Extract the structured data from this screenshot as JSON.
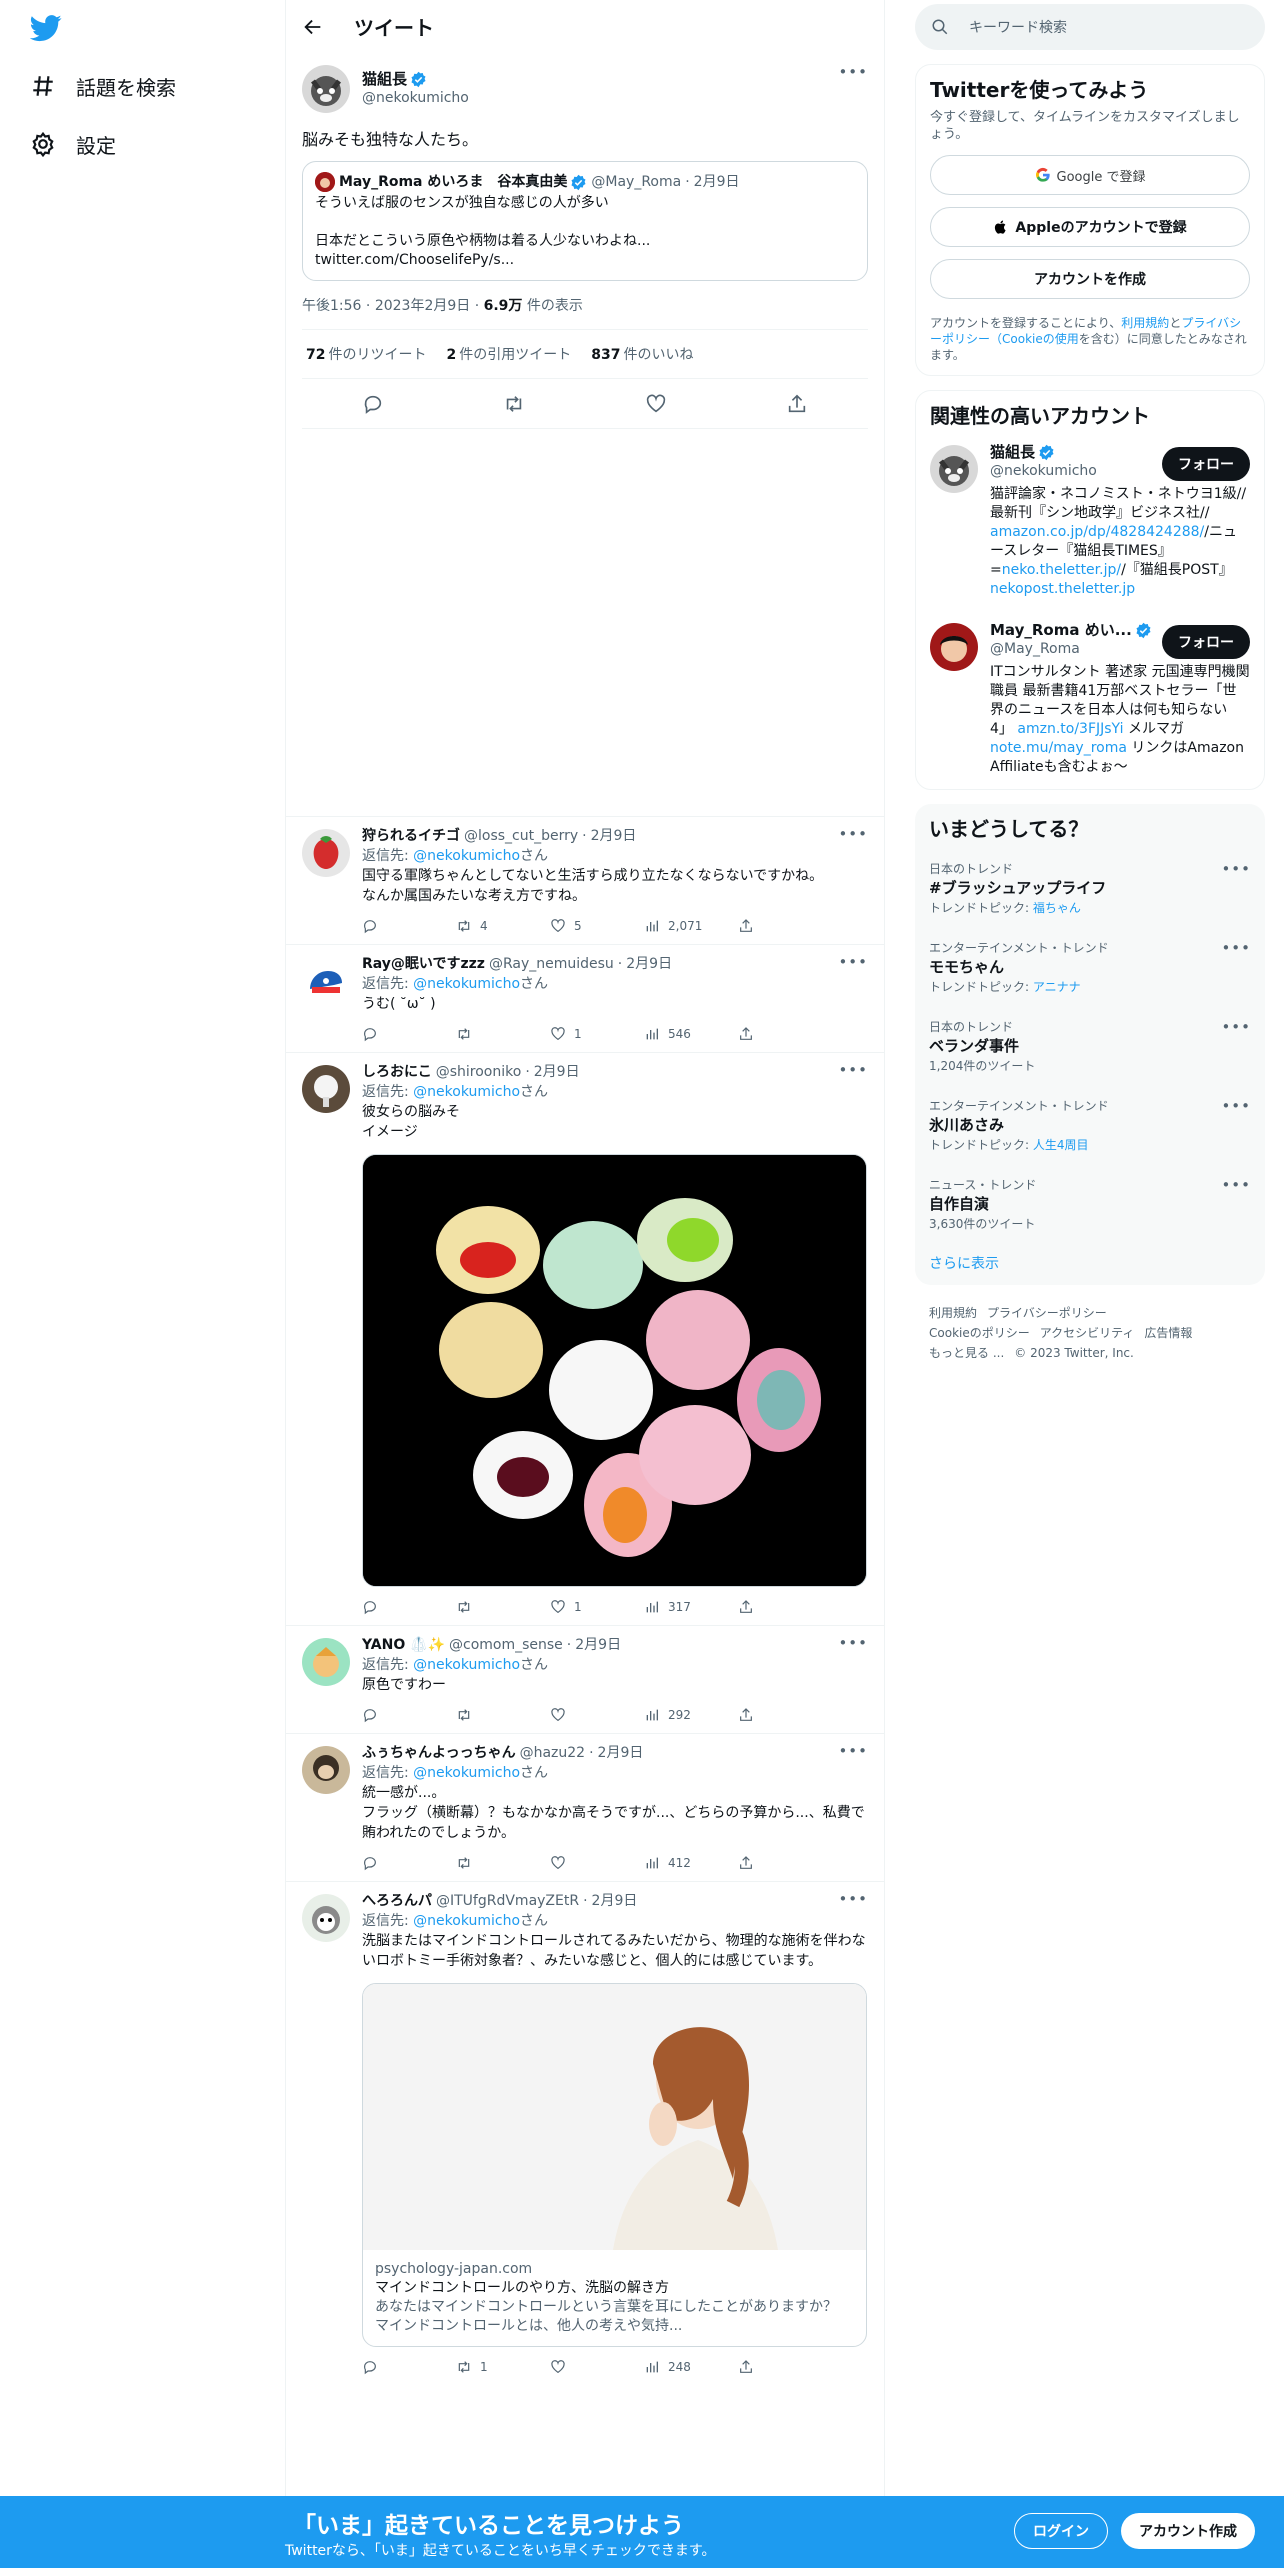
{
  "nav": {
    "explore_label": "話題を検索",
    "settings_label": "設定"
  },
  "header": {
    "title": "ツイート"
  },
  "main_tweet": {
    "name": "猫組長",
    "handle": "@nekokumicho",
    "text": "脳みそも独特な人たち。",
    "quote": {
      "name": "May_Roma めいろま　谷本真由美",
      "handle": "@May_Roma",
      "date": "2月9日",
      "text": "そういえば服のセンスが独自な感じの人が多い\n\n日本だとこういう原色や柄物は着る人少ないわよね...\ntwitter.com/ChooselifePy/s..."
    },
    "time": "午後1:56",
    "date": "2023年2月9日",
    "views_count": "6.9万",
    "views_label": "件の表示",
    "retweets_count": "72",
    "retweets_label": "件のリツイート",
    "quotes_count": "2",
    "quotes_label": "件の引用ツイート",
    "likes_count": "837",
    "likes_label": "件のいいね"
  },
  "replying_to_label": "返信先:",
  "replying_to_handle": "@nekokumicho",
  "replying_to_suffix": "さん",
  "replies": [
    {
      "name": "狩られるイチゴ",
      "handle": "@loss_cut_berry",
      "date": "2月9日",
      "text": "国守る軍隊ちゃんとしてないと生活すら成り立たなくならないですかね。\nなんか属国みたいな考え方ですね。",
      "replies": "",
      "retweets": "4",
      "likes": "5",
      "views": "2,071"
    },
    {
      "name": "Ray@眠いですzzz",
      "handle": "@Ray_nemuidesu",
      "date": "2月9日",
      "text": "うむ( ˘ω˘ )",
      "replies": "",
      "retweets": "",
      "likes": "1",
      "views": "546"
    },
    {
      "name": "しろおにこ",
      "handle": "@shirooniko",
      "date": "2月9日",
      "text": "彼女らの脳みそ\nイメージ",
      "replies": "",
      "retweets": "",
      "likes": "1",
      "views": "317"
    },
    {
      "name": "YANO 🥼✨",
      "handle": "@comom_sense",
      "date": "2月9日",
      "text": "原色ですわー",
      "replies": "",
      "retweets": "",
      "likes": "",
      "views": "292"
    },
    {
      "name": "ふぅちゃんよっっちゃん",
      "handle": "@hazu22",
      "date": "2月9日",
      "text": "統一感が...。\nフラッグ（横断幕）？もなかなか高そうですが...、どちらの予算から...、私費で賄われたのでしょうか。",
      "replies": "",
      "retweets": "",
      "likes": "",
      "views": "412"
    },
    {
      "name": "へろろんパ",
      "handle": "@ITUfgRdVmayZEtR",
      "date": "2月9日",
      "text": "洗脳またはマインドコントロールされてるみたいだから、物理的な施術を伴わないロボトミー手術対象者？、みたいな感じと、個人的には感じています。",
      "replies": "",
      "retweets": "1",
      "likes": "",
      "views": "248",
      "card": {
        "domain": "psychology-japan.com",
        "title": "マインドコントロールのやり方、洗脳の解き方",
        "desc": "あなたはマインドコントロールという言葉を耳にしたことがありますか？ マインドコントロールとは、他人の考えや気持..."
      }
    }
  ],
  "sidebar": {
    "search_placeholder": "キーワード検索",
    "signup": {
      "title": "Twitterを使ってみよう",
      "subtitle": "今すぐ登録して、タイムラインをカスタマイズしましょう。",
      "google_label": "Google で登録",
      "apple_label": "Appleのアカウントで登録",
      "create_label": "アカウントを作成",
      "terms_pre": "アカウントを登録することにより、",
      "terms_link1": "利用規約",
      "terms_mid": "と",
      "terms_link2": "プライバシーポリシー（Cookieの使用",
      "terms_post": "を含む）に同意したとみなされます。"
    },
    "related": {
      "title": "関連性の高いアカウント",
      "follow_label": "フォロー",
      "accounts": [
        {
          "name": "猫組長",
          "handle": "@nekokumicho",
          "bio_a": "猫評論家・ネコノミスト・ネトウヨ1級//最新刊『シン地政学』ビジネス社// ",
          "link_a": "amazon.co.jp/dp/4828424288/",
          "bio_b": "/ニュースレター『猫組長TIMES』=",
          "link_b": "neko.theletter.jp/",
          "bio_c": "/『猫組長POST』",
          "link_c": "nekopost.theletter.jp"
        },
        {
          "name": "May_Roma めい...",
          "handle": "@May_Roma",
          "bio_a": "ITコンサルタント 著述家 元国連専門機関職員 最新書籍41万部ベストセラー「世界のニュースを日本人は何も知らない4」",
          "link_a": "amzn.to/3FJJsYi",
          "bio_b": " メルマガ",
          "link_b": "note.mu/may_roma",
          "bio_c": " リンクはAmazon Affiliateも含むよぉ〜",
          "link_c": ""
        }
      ]
    },
    "trends": {
      "title": "いまどうしてる？",
      "items": [
        {
          "category": "日本のトレンド",
          "name": "#ブラッシュアップライフ",
          "sub_label": "トレンドトピック:",
          "sub_link": "福ちゃん"
        },
        {
          "category": "エンターテインメント・トレンド",
          "name": "モモちゃん",
          "sub_label": "トレンドトピック:",
          "sub_link": "アニナナ"
        },
        {
          "category": "日本のトレンド",
          "name": "ベランダ事件",
          "sub_label": "1,204件のツイート",
          "sub_link": ""
        },
        {
          "category": "エンターテインメント・トレンド",
          "name": "氷川あさみ",
          "sub_label": "トレンドトピック:",
          "sub_link": "人生4周目"
        },
        {
          "category": "ニュース・トレンド",
          "name": "自作自演",
          "sub_label": "3,630件のツイート",
          "sub_link": ""
        }
      ],
      "show_more": "さらに表示"
    },
    "footer": {
      "line1": [
        "利用規約",
        "プライバシーポリシー"
      ],
      "line2": [
        "Cookieのポリシー",
        "アクセシビリティ",
        "広告情報"
      ],
      "line3": [
        "もっと見る ...",
        "© 2023 Twitter, Inc."
      ]
    }
  },
  "banner": {
    "title": "「いま」起きていることを見つけよう",
    "subtitle": "Twitterなら、「いま」起きていることをいち早くチェックできます。",
    "login_label": "ログイン",
    "signup_label": "アカウント作成"
  },
  "colors": {
    "accent": "#1d9bf0",
    "text": "#0f1419",
    "muted": "#536471"
  }
}
